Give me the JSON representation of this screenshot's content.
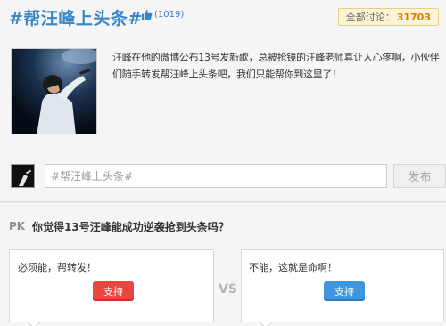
{
  "topic": {
    "title": "#帮汪峰上头条#",
    "like_count": "(1019)",
    "total_label": "全部讨论：",
    "total_count": "31703",
    "description": "汪峰在他的微博公布13号发新歌，总被抢镜的汪峰老师真让人心疼啊，小伙伴们随手转发帮汪峰上头条吧，我们只能帮你到这里了！"
  },
  "composer": {
    "placeholder": "#帮汪峰上头条#",
    "publish_label": "发布"
  },
  "pk": {
    "tag": "PK",
    "question": "你觉得13号汪峰能成功逆袭抢到头条吗？",
    "vs": "VS",
    "left": {
      "text": "必须能，帮转发！",
      "button": "支持",
      "color": "#e8473f"
    },
    "right": {
      "text": "不能，这就是命啊！",
      "button": "支持",
      "color": "#3f96de"
    }
  },
  "icons": {
    "like": "thumbs-up-icon",
    "cover": "singer-cover-image",
    "avatar": "user-avatar-image"
  },
  "colors": {
    "accent_blue": "#3a86c8",
    "count_orange": "#e07b00"
  }
}
